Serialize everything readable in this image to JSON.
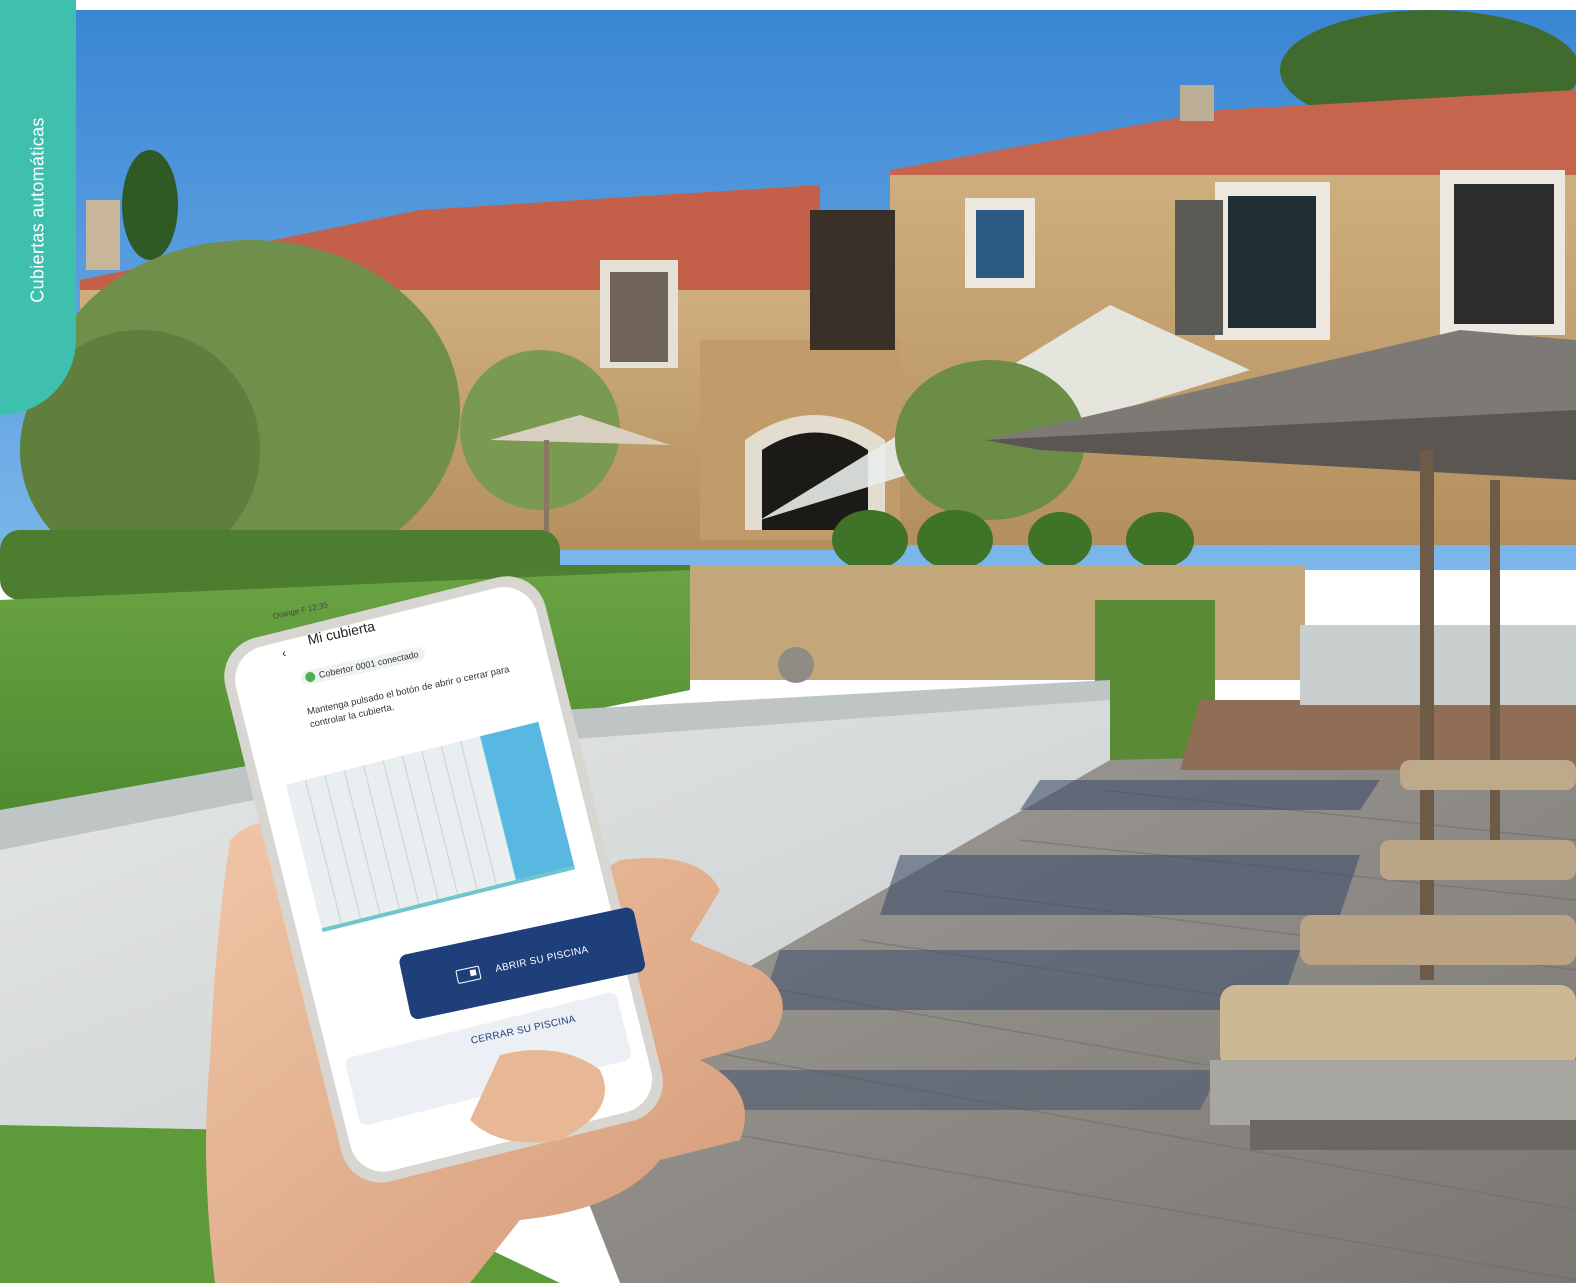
{
  "side_tab": {
    "label": "Cubiertas automáticas",
    "color": "#3fbfae"
  },
  "phone_screen": {
    "status_bar": "Orange F 12:35",
    "title": "Mi cubierta",
    "back_icon": "chevron-left-icon",
    "connection_status": "Cobertor 0001 conectado",
    "instruction": "Mantenga pulsado el botón de abrir o cerrar para controlar la cubierta.",
    "open_button_label": "ABRIR SU PISCINA",
    "close_button_label": "CERRAR SU PISCINA",
    "accent_color": "#1e3f7a"
  },
  "scene_description_colors": {
    "sky": "#3f8fd6",
    "grass": "#5a9a3a",
    "stone_house": "#c4a272",
    "roof": "#c4604a",
    "pool_cover": "#d8dcdc",
    "deck": "#8f8c88"
  }
}
